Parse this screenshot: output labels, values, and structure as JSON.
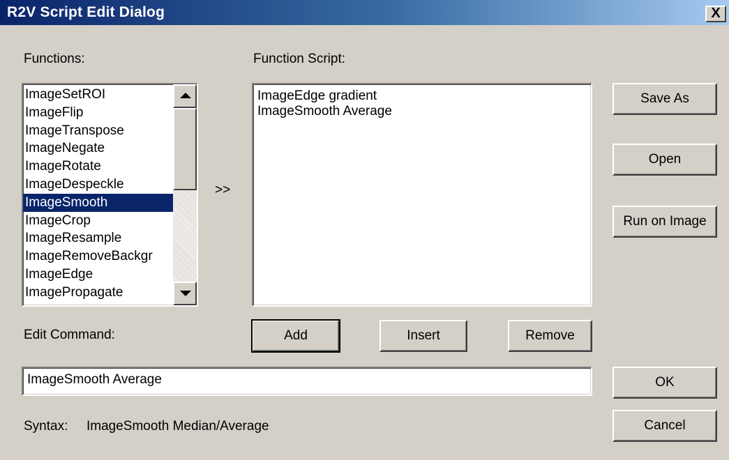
{
  "window": {
    "title": "R2V Script Edit Dialog",
    "close_glyph": "X"
  },
  "functions": {
    "label": "Functions:",
    "items": [
      "ImageSetROI",
      "ImageFlip",
      "ImageTranspose",
      "ImageNegate",
      "ImageRotate",
      "ImageDespeckle",
      "ImageSmooth",
      "ImageCrop",
      "ImageResample",
      "ImageRemoveBackgr",
      "ImageEdge",
      "ImagePropagate"
    ],
    "selected": "ImageSmooth"
  },
  "transfer": {
    "label": ">>"
  },
  "script": {
    "label": "Function Script:",
    "lines": [
      "ImageEdge gradient",
      "ImageSmooth Average"
    ]
  },
  "buttons": {
    "save_as": "Save As",
    "open": "Open",
    "run_on_image": "Run on Image",
    "add": "Add",
    "insert": "Insert",
    "remove": "Remove",
    "ok": "OK",
    "cancel": "Cancel"
  },
  "edit_command": {
    "label": "Edit Command:",
    "value": "ImageSmooth Average"
  },
  "syntax": {
    "label": "Syntax:",
    "value": "ImageSmooth Median/Average"
  },
  "colors": {
    "dialog_bg": "#d4d0c8",
    "title_active": "#0a246a",
    "selection": "#0a246a"
  }
}
